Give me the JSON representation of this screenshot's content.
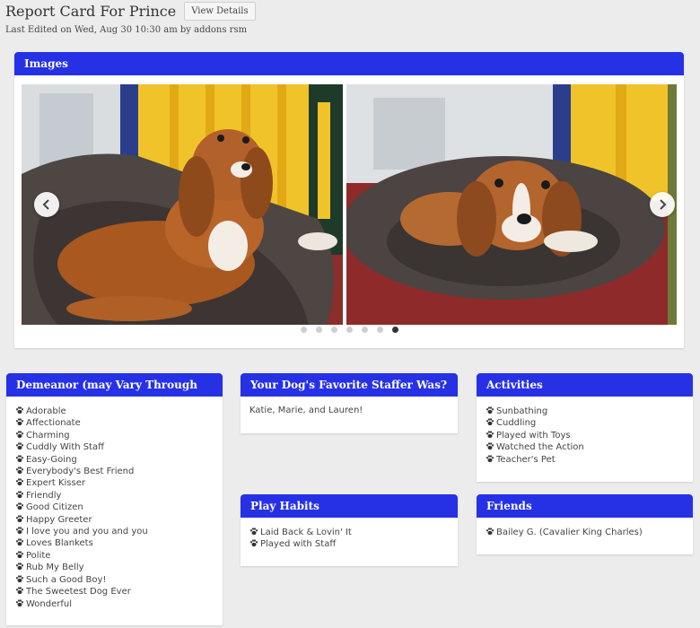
{
  "header": {
    "title": "Report Card For Prince",
    "view_details_label": "View Details",
    "last_edited": "Last Edited on Wed, Aug 30 10:30 am by addons rsm"
  },
  "images": {
    "title": "Images",
    "dot_count": 7,
    "active_dot": 6
  },
  "demeanor": {
    "title": "Demeanor (may Vary Through Day)",
    "items": [
      "Adorable",
      "Affectionate",
      "Charming",
      "Cuddly With Staff",
      "Easy-Going",
      "Everybody's Best Friend",
      "Expert Kisser",
      "Friendly",
      "Good Citizen",
      "Happy Greeter",
      "I love you and you and you",
      "Loves Blankets",
      "Polite",
      "Rub My Belly",
      "Such a Good Boy!",
      "The Sweetest Dog Ever",
      "Wonderful"
    ]
  },
  "staffer": {
    "title": "Your Dog's Favorite Staffer Was?",
    "text": "Katie, Marie, and Lauren!"
  },
  "play_habits": {
    "title": "Play Habits",
    "items": [
      "Laid Back & Lovin' It",
      "Played with Staff"
    ]
  },
  "activities": {
    "title": "Activities",
    "items": [
      "Sunbathing",
      "Cuddling",
      "Played with Toys",
      "Watched the Action",
      "Teacher's Pet"
    ]
  },
  "friends": {
    "title": "Friends",
    "items": [
      "Bailey G. (Cavalier King Charles)"
    ]
  },
  "colors": {
    "header_blue": "#2631e6",
    "background": "#ececec"
  },
  "icons": {
    "list_bullet": "paw-icon",
    "prev": "chevron-left-icon",
    "next": "chevron-right-icon"
  }
}
